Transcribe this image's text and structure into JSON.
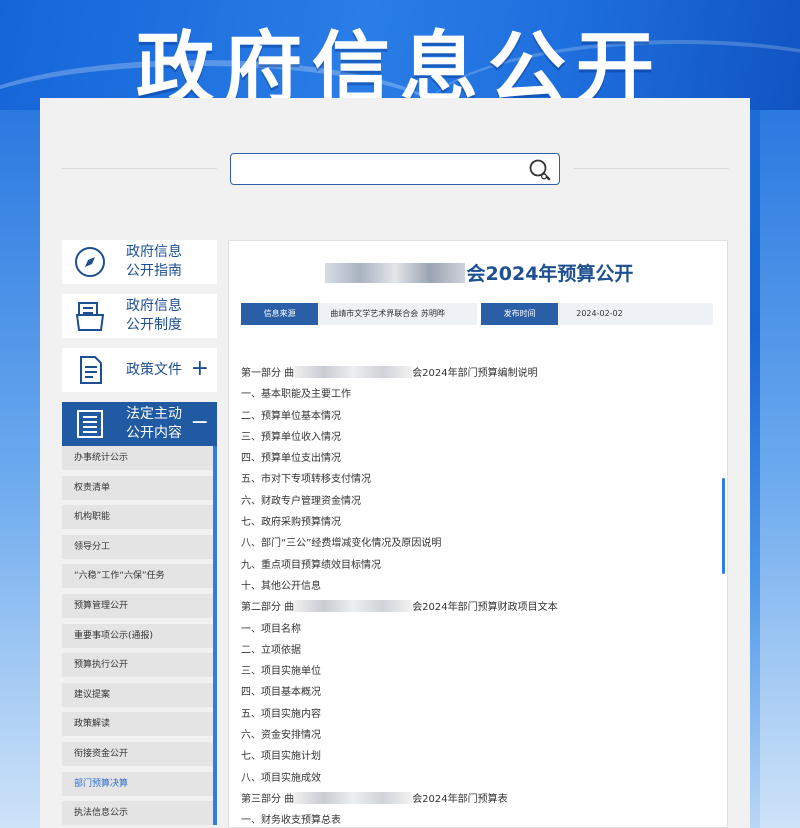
{
  "banner": {
    "title": "政府信息公开"
  },
  "search": {
    "value": "",
    "placeholder": ""
  },
  "nav": {
    "cards": [
      {
        "label": "政府信息公开指南",
        "icon": "compass-icon"
      },
      {
        "label": "政府信息公开制度",
        "icon": "documents-icon"
      },
      {
        "label": "政策文件",
        "icon": "file-icon",
        "toggle": "+"
      },
      {
        "label": "法定主动公开内容",
        "icon": "list-icon",
        "toggle": "−",
        "active": true
      }
    ],
    "sub_items": [
      "办事统计公示",
      "权责清单",
      "机构职能",
      "领导分工",
      "“六稳”工作“六保”任务",
      "预算管理公开",
      "重要事项公示(通报)",
      "预算执行公开",
      "建议提案",
      "政策解读",
      "衔接资金公开",
      "部门预算决算",
      "执法信息公示"
    ],
    "current_sub": "部门预算决算"
  },
  "document": {
    "title_suffix": "会2024年预算公开",
    "source_label": "信息来源",
    "source_value": "曲靖市文学艺术界联合会 苏明晔",
    "date_label": "发布时间",
    "date_value": "2024-02-02",
    "lines": [
      {
        "prefix": "第一部分 曲",
        "suffix": "会2024年部门预算编制说明",
        "blurred": true
      },
      {
        "text": "一、基本职能及主要工作"
      },
      {
        "text": "二、预算单位基本情况"
      },
      {
        "text": "三、预算单位收入情况"
      },
      {
        "text": "四、预算单位支出情况"
      },
      {
        "text": "五、市对下专项转移支付情况"
      },
      {
        "text": "六、财政专户管理资金情况"
      },
      {
        "text": "七、政府采购预算情况"
      },
      {
        "text": "八、部门“三公”经费增减变化情况及原因说明"
      },
      {
        "text": "九、重点项目预算绩效目标情况"
      },
      {
        "text": "十、其他公开信息"
      },
      {
        "prefix": "第二部分 曲",
        "suffix": "会2024年部门预算财政项目文本",
        "blurred": true
      },
      {
        "text": "一、项目名称"
      },
      {
        "text": "二、立项依据"
      },
      {
        "text": "三、项目实施单位"
      },
      {
        "text": "四、项目基本概况"
      },
      {
        "text": "五、项目实施内容"
      },
      {
        "text": "六、资金安排情况"
      },
      {
        "text": "七、项目实施计划"
      },
      {
        "text": "八、项目实施成效"
      },
      {
        "prefix": "第三部分 曲",
        "suffix": "会2024年部门预算表",
        "blurred": true
      },
      {
        "text": "一、财务收支预算总表"
      }
    ]
  },
  "colors": {
    "brand": "#205aa3",
    "accent": "#2f7de2",
    "title": "#1d4f91"
  }
}
